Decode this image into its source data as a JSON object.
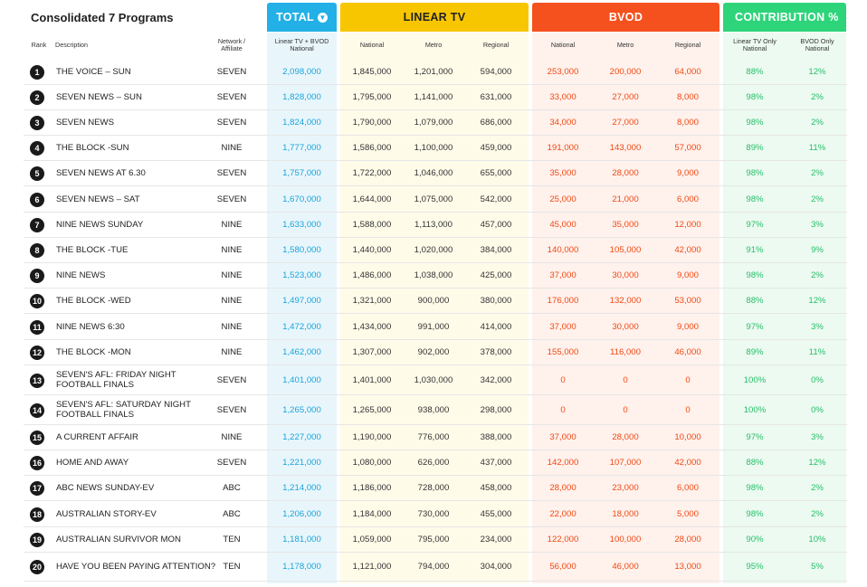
{
  "title": "Consolidated 7 Programs",
  "groups": {
    "total": "TOTAL",
    "linear": "LINEAR TV",
    "bvod": "BVOD",
    "contrib": "CONTRIBUTION %"
  },
  "sub": {
    "rank": "Rank",
    "description": "Description",
    "network": "Network / Affiliate",
    "total": "Linear TV + BVOD National",
    "lin_national": "National",
    "lin_metro": "Metro",
    "lin_regional": "Regional",
    "bvod_national": "National",
    "bvod_metro": "Metro",
    "bvod_regional": "Regional",
    "contrib_linear": "Linear TV Only National",
    "contrib_bvod": "BVOD Only National"
  },
  "rows": [
    {
      "rank": "1",
      "desc": "THE VOICE – SUN",
      "net": "SEVEN",
      "total": "2,098,000",
      "ln": "1,845,000",
      "lm": "1,201,000",
      "lr": "594,000",
      "bn": "253,000",
      "bm": "200,000",
      "br": "64,000",
      "cl": "88%",
      "cb": "12%"
    },
    {
      "rank": "2",
      "desc": "SEVEN NEWS – SUN",
      "net": "SEVEN",
      "total": "1,828,000",
      "ln": "1,795,000",
      "lm": "1,141,000",
      "lr": "631,000",
      "bn": "33,000",
      "bm": "27,000",
      "br": "8,000",
      "cl": "98%",
      "cb": "2%"
    },
    {
      "rank": "3",
      "desc": "SEVEN NEWS",
      "net": "SEVEN",
      "total": "1,824,000",
      "ln": "1,790,000",
      "lm": "1,079,000",
      "lr": "686,000",
      "bn": "34,000",
      "bm": "27,000",
      "br": "8,000",
      "cl": "98%",
      "cb": "2%"
    },
    {
      "rank": "4",
      "desc": "THE BLOCK -SUN",
      "net": "NINE",
      "total": "1,777,000",
      "ln": "1,586,000",
      "lm": "1,100,000",
      "lr": "459,000",
      "bn": "191,000",
      "bm": "143,000",
      "br": "57,000",
      "cl": "89%",
      "cb": "11%"
    },
    {
      "rank": "5",
      "desc": "SEVEN NEWS AT 6.30",
      "net": "SEVEN",
      "total": "1,757,000",
      "ln": "1,722,000",
      "lm": "1,046,000",
      "lr": "655,000",
      "bn": "35,000",
      "bm": "28,000",
      "br": "9,000",
      "cl": "98%",
      "cb": "2%"
    },
    {
      "rank": "6",
      "desc": "SEVEN NEWS – SAT",
      "net": "SEVEN",
      "total": "1,670,000",
      "ln": "1,644,000",
      "lm": "1,075,000",
      "lr": "542,000",
      "bn": "25,000",
      "bm": "21,000",
      "br": "6,000",
      "cl": "98%",
      "cb": "2%"
    },
    {
      "rank": "7",
      "desc": "NINE NEWS SUNDAY",
      "net": "NINE",
      "total": "1,633,000",
      "ln": "1,588,000",
      "lm": "1,113,000",
      "lr": "457,000",
      "bn": "45,000",
      "bm": "35,000",
      "br": "12,000",
      "cl": "97%",
      "cb": "3%"
    },
    {
      "rank": "8",
      "desc": "THE BLOCK -TUE",
      "net": "NINE",
      "total": "1,580,000",
      "ln": "1,440,000",
      "lm": "1,020,000",
      "lr": "384,000",
      "bn": "140,000",
      "bm": "105,000",
      "br": "42,000",
      "cl": "91%",
      "cb": "9%"
    },
    {
      "rank": "9",
      "desc": "NINE NEWS",
      "net": "NINE",
      "total": "1,523,000",
      "ln": "1,486,000",
      "lm": "1,038,000",
      "lr": "425,000",
      "bn": "37,000",
      "bm": "30,000",
      "br": "9,000",
      "cl": "98%",
      "cb": "2%"
    },
    {
      "rank": "10",
      "desc": "THE BLOCK -WED",
      "net": "NINE",
      "total": "1,497,000",
      "ln": "1,321,000",
      "lm": "900,000",
      "lr": "380,000",
      "bn": "176,000",
      "bm": "132,000",
      "br": "53,000",
      "cl": "88%",
      "cb": "12%"
    },
    {
      "rank": "11",
      "desc": "NINE NEWS 6:30",
      "net": "NINE",
      "total": "1,472,000",
      "ln": "1,434,000",
      "lm": "991,000",
      "lr": "414,000",
      "bn": "37,000",
      "bm": "30,000",
      "br": "9,000",
      "cl": "97%",
      "cb": "3%"
    },
    {
      "rank": "12",
      "desc": "THE BLOCK -MON",
      "net": "NINE",
      "total": "1,462,000",
      "ln": "1,307,000",
      "lm": "902,000",
      "lr": "378,000",
      "bn": "155,000",
      "bm": "116,000",
      "br": "46,000",
      "cl": "89%",
      "cb": "11%"
    },
    {
      "rank": "13",
      "desc": "SEVEN'S AFL: FRIDAY NIGHT FOOTBALL FINALS",
      "net": "SEVEN",
      "total": "1,401,000",
      "ln": "1,401,000",
      "lm": "1,030,000",
      "lr": "342,000",
      "bn": "0",
      "bm": "0",
      "br": "0",
      "cl": "100%",
      "cb": "0%"
    },
    {
      "rank": "14",
      "desc": "SEVEN'S AFL: SATURDAY NIGHT FOOTBALL FINALS",
      "net": "SEVEN",
      "total": "1,265,000",
      "ln": "1,265,000",
      "lm": "938,000",
      "lr": "298,000",
      "bn": "0",
      "bm": "0",
      "br": "0",
      "cl": "100%",
      "cb": "0%"
    },
    {
      "rank": "15",
      "desc": "A CURRENT AFFAIR",
      "net": "NINE",
      "total": "1,227,000",
      "ln": "1,190,000",
      "lm": "776,000",
      "lr": "388,000",
      "bn": "37,000",
      "bm": "28,000",
      "br": "10,000",
      "cl": "97%",
      "cb": "3%"
    },
    {
      "rank": "16",
      "desc": "HOME AND AWAY",
      "net": "SEVEN",
      "total": "1,221,000",
      "ln": "1,080,000",
      "lm": "626,000",
      "lr": "437,000",
      "bn": "142,000",
      "bm": "107,000",
      "br": "42,000",
      "cl": "88%",
      "cb": "12%"
    },
    {
      "rank": "17",
      "desc": "ABC NEWS SUNDAY-EV",
      "net": "ABC",
      "total": "1,214,000",
      "ln": "1,186,000",
      "lm": "728,000",
      "lr": "458,000",
      "bn": "28,000",
      "bm": "23,000",
      "br": "6,000",
      "cl": "98%",
      "cb": "2%"
    },
    {
      "rank": "18",
      "desc": "AUSTRALIAN STORY-EV",
      "net": "ABC",
      "total": "1,206,000",
      "ln": "1,184,000",
      "lm": "730,000",
      "lr": "455,000",
      "bn": "22,000",
      "bm": "18,000",
      "br": "5,000",
      "cl": "98%",
      "cb": "2%"
    },
    {
      "rank": "19",
      "desc": "AUSTRALIAN SURVIVOR MON",
      "net": "TEN",
      "total": "1,181,000",
      "ln": "1,059,000",
      "lm": "795,000",
      "lr": "234,000",
      "bn": "122,000",
      "bm": "100,000",
      "br": "28,000",
      "cl": "90%",
      "cb": "10%"
    },
    {
      "rank": "20",
      "desc": "HAVE YOU BEEN PAYING ATTENTION?",
      "net": "TEN",
      "total": "1,178,000",
      "ln": "1,121,000",
      "lm": "794,000",
      "lr": "304,000",
      "bn": "56,000",
      "bm": "46,000",
      "br": "13,000",
      "cl": "95%",
      "cb": "5%"
    }
  ]
}
